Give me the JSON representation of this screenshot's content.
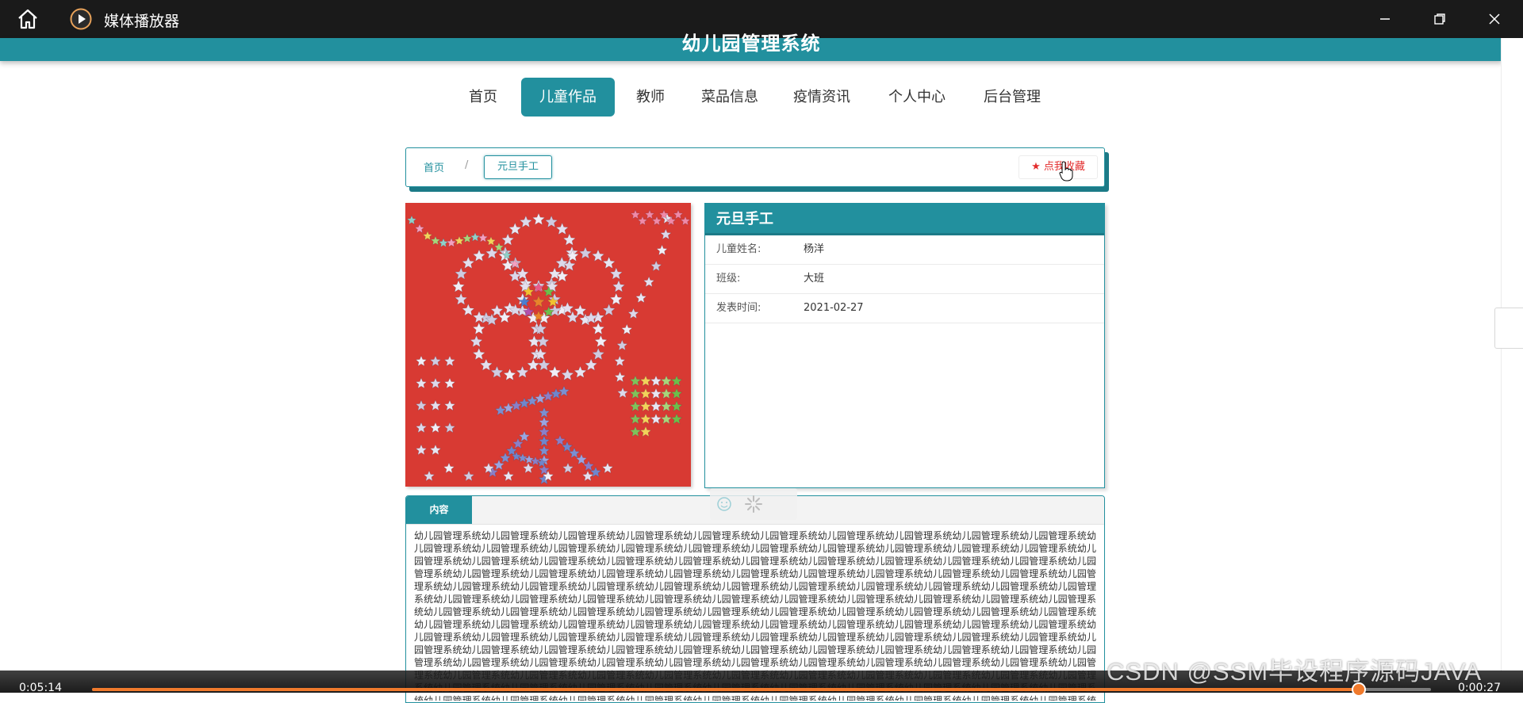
{
  "player": {
    "title": "媒体播放器",
    "time_elapsed": "0:05:14",
    "time_remaining": "0:00:27",
    "progress": 0.946
  },
  "site": {
    "title": "幼儿园管理系统"
  },
  "nav": {
    "items": [
      {
        "label": "首页",
        "active": false
      },
      {
        "label": "儿童作品",
        "active": true
      },
      {
        "label": "教师",
        "active": false
      },
      {
        "label": "菜品信息",
        "active": false
      },
      {
        "label": "疫情资讯",
        "active": false
      },
      {
        "label": "个人中心",
        "active": false
      },
      {
        "label": "后台管理",
        "active": false
      }
    ]
  },
  "breadcrumb": {
    "home": "首页",
    "separator": "/",
    "current": "元旦手工",
    "favorite_label": "点我收藏"
  },
  "detail": {
    "title": "元旦手工",
    "rows": [
      {
        "label": "儿童姓名:",
        "value": "杨洋"
      },
      {
        "label": "班级:",
        "value": "大班"
      },
      {
        "label": "发表时间:",
        "value": "2021-02-27"
      }
    ]
  },
  "content": {
    "tab_label": "内容",
    "repeat_unit": "幼儿园管理系统",
    "repeat_count": 180
  },
  "watermark": "CSDN @SSM毕设程序源码JAVA",
  "colors": {
    "primary": "#22909e",
    "primary_dark": "#1c7a87",
    "favorite": "#e32d2d",
    "progress": "#f07a2c"
  }
}
